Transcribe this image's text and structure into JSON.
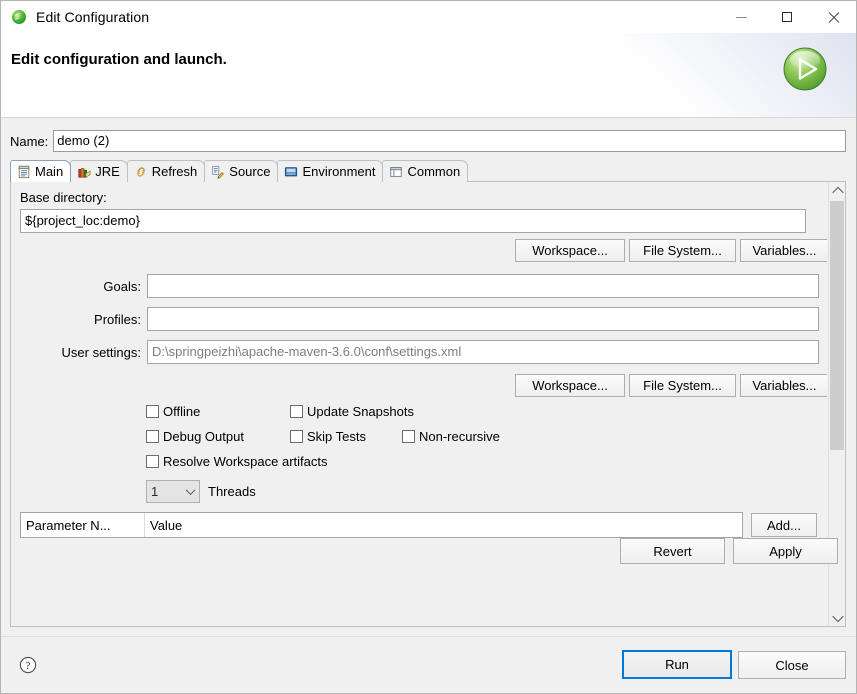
{
  "window": {
    "title": "Edit Configuration",
    "app_icon": "eclipse-icon",
    "minimize_label": "Minimize",
    "maximize_label": "Maximize",
    "close_label": "Close"
  },
  "header": {
    "title": "Edit configuration and launch.",
    "badge_icon": "run-play-icon"
  },
  "name_field": {
    "label": "Name:",
    "value": "demo (2)"
  },
  "tabs": [
    {
      "label": "Main",
      "icon": "main-document-icon",
      "active": true
    },
    {
      "label": "JRE",
      "icon": "jre-books-icon",
      "active": false
    },
    {
      "label": "Refresh",
      "icon": "refresh-links-icon",
      "active": false
    },
    {
      "label": "Source",
      "icon": "source-pencil-icon",
      "active": false
    },
    {
      "label": "Environment",
      "icon": "environment-icon",
      "active": false
    },
    {
      "label": "Common",
      "icon": "common-window-icon",
      "active": false
    }
  ],
  "main_tab": {
    "base_directory": {
      "label": "Base directory:",
      "value": "${project_loc:demo}"
    },
    "browse_buttons_top": [
      {
        "label": "Workspace..."
      },
      {
        "label": "File System..."
      },
      {
        "label": "Variables..."
      }
    ],
    "goals": {
      "label": "Goals:",
      "value": ""
    },
    "profiles": {
      "label": "Profiles:",
      "value": ""
    },
    "user_settings": {
      "label": "User settings:",
      "value": "D:\\springpeizhi\\apache-maven-3.6.0\\conf\\settings.xml"
    },
    "browse_buttons_bottom": [
      {
        "label": "Workspace..."
      },
      {
        "label": "File System..."
      },
      {
        "label": "Variables..."
      }
    ],
    "checkboxes": [
      {
        "label": "Offline",
        "checked": false
      },
      {
        "label": "Update Snapshots",
        "checked": false
      },
      {
        "label": "Debug Output",
        "checked": false
      },
      {
        "label": "Skip Tests",
        "checked": false
      },
      {
        "label": "Non-recursive",
        "checked": false
      },
      {
        "label": "Resolve Workspace artifacts",
        "checked": false
      }
    ],
    "threads": {
      "value": "1",
      "label": "Threads"
    },
    "parameter_table": {
      "columns": [
        "Parameter N...",
        "Value"
      ],
      "rows": [],
      "add_button": "Add..."
    },
    "revert_button": "Revert",
    "apply_button": "Apply"
  },
  "footer": {
    "help_icon": "help-question-icon",
    "run_button": "Run",
    "close_button": "Close"
  },
  "colors": {
    "accent": "#0078d7",
    "window_bg": "#f0f0f0",
    "field_bg": "#ffffff",
    "run_green": "#72b93b",
    "ghost_text": "#7d7d7d"
  }
}
